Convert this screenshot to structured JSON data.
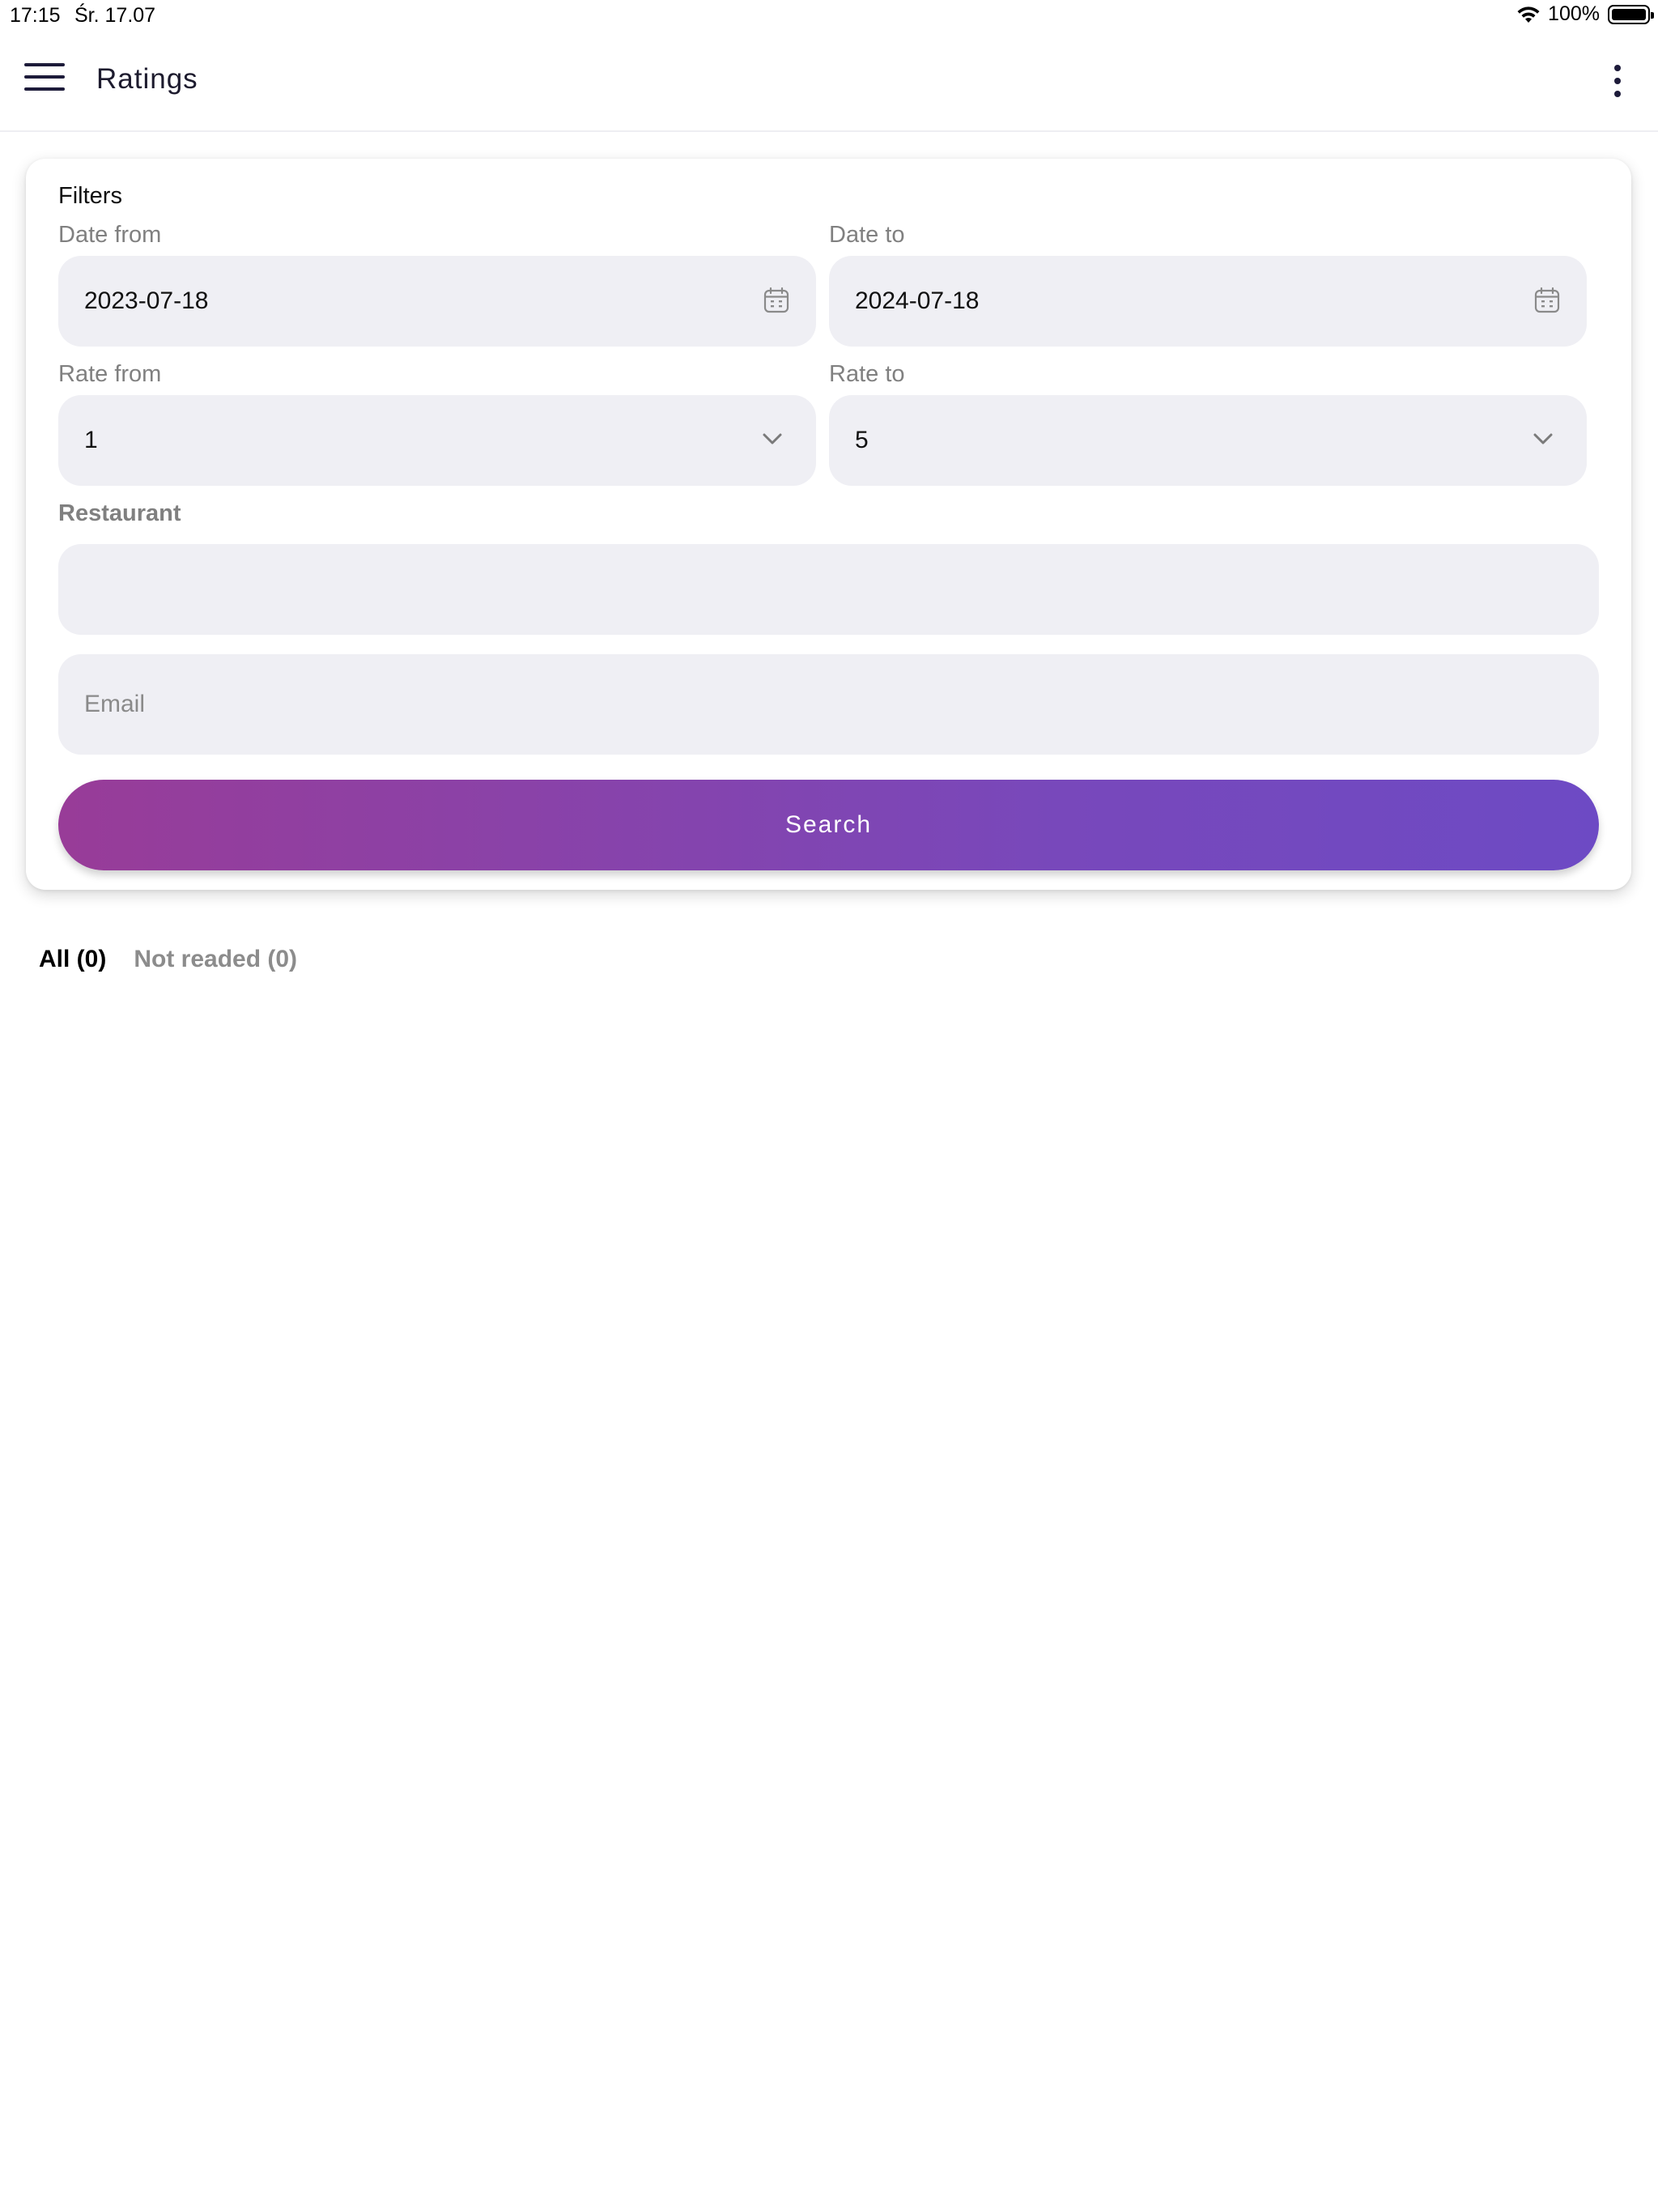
{
  "status_bar": {
    "time": "17:15",
    "date": "Śr. 17.07",
    "battery": "100%",
    "icons": [
      "wifi-icon",
      "battery-icon"
    ]
  },
  "app_bar": {
    "title": "Ratings",
    "icons": [
      "hamburger-menu-icon",
      "more-vert-icon"
    ]
  },
  "filters": {
    "title": "Filters",
    "date_from": {
      "label": "Date from",
      "value": "2023-07-18",
      "icon": "calendar-icon"
    },
    "date_to": {
      "label": "Date to",
      "value": "2024-07-18",
      "icon": "calendar-icon"
    },
    "rate_from": {
      "label": "Rate from",
      "value": "1",
      "icon": "chevron-down-icon"
    },
    "rate_to": {
      "label": "Rate to",
      "value": "5",
      "icon": "chevron-down-icon"
    },
    "restaurant": {
      "label": "Restaurant",
      "value": ""
    },
    "email": {
      "placeholder": "Email",
      "value": ""
    },
    "search_label": "Search"
  },
  "tabs": [
    {
      "label": "All (0)",
      "active": true
    },
    {
      "label": "Not readed (0)",
      "active": false
    }
  ],
  "colors": {
    "input_bg": "#efeff4",
    "button_gradient_start": "#983c98",
    "button_gradient_end": "#6d4ac4",
    "label": "#808080"
  }
}
